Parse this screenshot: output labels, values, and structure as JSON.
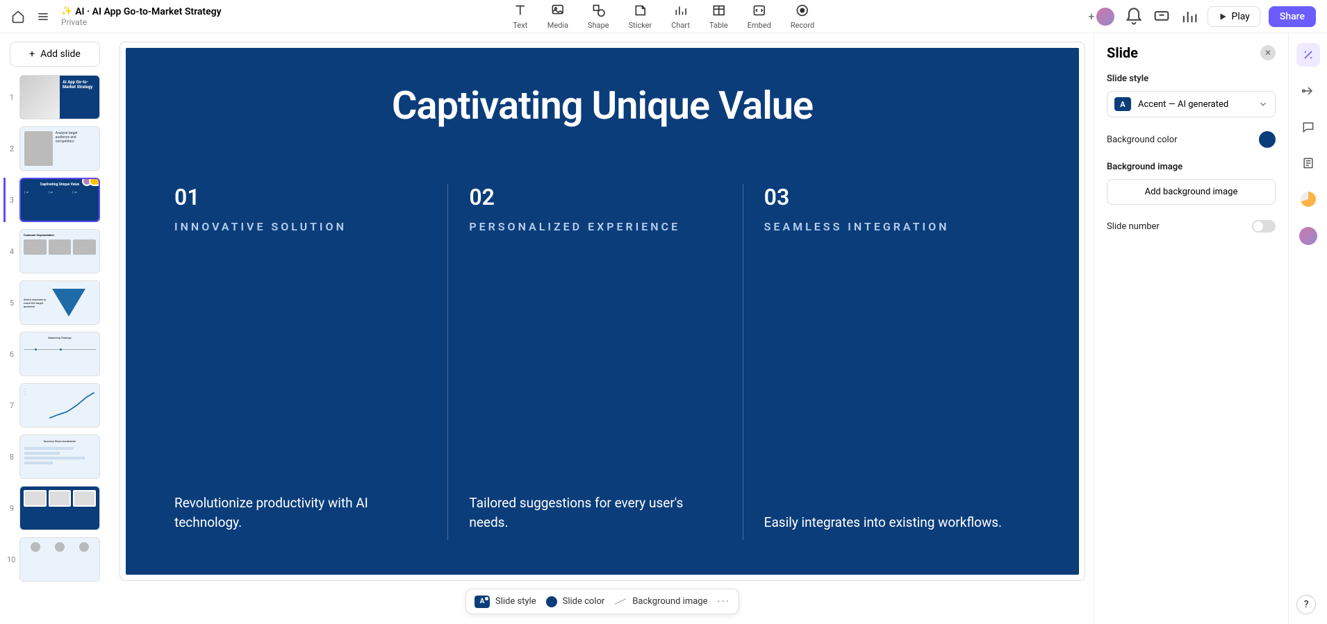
{
  "doc": {
    "title": "AI · AI App Go-to-Market Strategy",
    "privacy": "Private"
  },
  "tools": {
    "text": "Text",
    "media": "Media",
    "shape": "Shape",
    "sticker": "Sticker",
    "chart": "Chart",
    "table": "Table",
    "embed": "Embed",
    "record": "Record"
  },
  "topbar": {
    "play": "Play",
    "share": "Share"
  },
  "sidebar": {
    "add_slide": "Add slide",
    "thumbs": [
      "1",
      "2",
      "3",
      "4",
      "5",
      "6",
      "7",
      "8",
      "9",
      "10"
    ]
  },
  "slide": {
    "title": "Captivating Unique Value",
    "cols": [
      {
        "num": "01",
        "head": "INNOVATIVE SOLUTION",
        "body": "Revolutionize productivity with AI technology."
      },
      {
        "num": "02",
        "head": "PERSONALIZED EXPERIENCE",
        "body": "Tailored suggestions for every user's needs."
      },
      {
        "num": "03",
        "head": "SEAMLESS INTEGRATION",
        "body": "Easily integrates into existing workflows."
      }
    ]
  },
  "bottom": {
    "style": "Slide style",
    "color": "Slide color",
    "bg": "Background image"
  },
  "panel": {
    "title": "Slide",
    "style_label": "Slide style",
    "style_value": "Accent — AI generated",
    "bg_color_label": "Background color",
    "bg_image_label": "Background image",
    "add_bg": "Add background image",
    "slide_number": "Slide number"
  },
  "colors": {
    "accent": "#0b3d7a",
    "primary": "#6b5cff"
  }
}
